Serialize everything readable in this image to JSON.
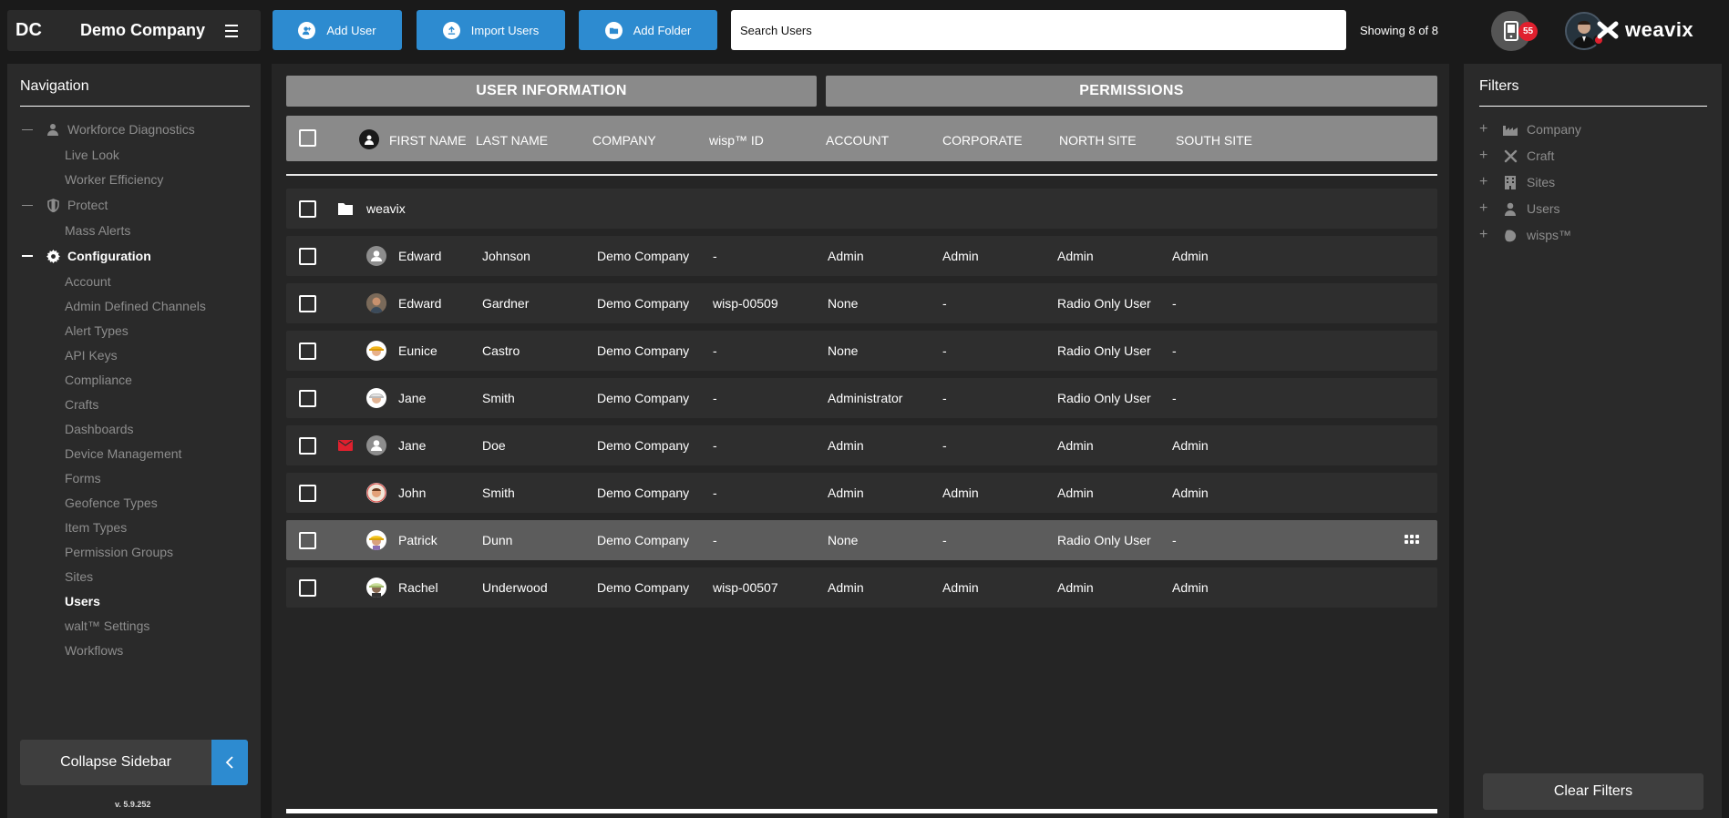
{
  "header": {
    "logo": "DC",
    "company": "Demo Company",
    "add_user": "Add User",
    "import_users": "Import Users",
    "add_folder": "Add Folder",
    "search_placeholder": "Search Users",
    "showing": "Showing 8 of 8",
    "notification_count": "55",
    "brand": "weavix"
  },
  "sidebar": {
    "title": "Navigation",
    "groups": [
      {
        "label": "Workforce Diagnostics",
        "icon": "person-icon",
        "items": [
          "Live Look",
          "Worker Efficiency"
        ]
      },
      {
        "label": "Protect",
        "icon": "shield-icon",
        "items": [
          "Mass Alerts"
        ]
      },
      {
        "label": "Configuration",
        "icon": "gear-icon",
        "active": true,
        "items": [
          "Account",
          "Admin Defined Channels",
          "Alert Types",
          "API Keys",
          "Compliance",
          "Crafts",
          "Dashboards",
          "Device Management",
          "Forms",
          "Geofence Types",
          "Item Types",
          "Permission Groups",
          "Sites",
          "Users",
          "walt™ Settings",
          "Workflows"
        ],
        "active_item": "Users"
      }
    ],
    "collapse_label": "Collapse Sidebar",
    "version": "v. 5.9.252"
  },
  "main": {
    "tabs": [
      "USER INFORMATION",
      "PERMISSIONS"
    ],
    "columns": [
      "FIRST NAME",
      "LAST NAME",
      "COMPANY",
      "wisp™ ID",
      "ACCOUNT",
      "CORPORATE",
      "NORTH SITE",
      "SOUTH SITE"
    ],
    "folder": "weavix",
    "rows": [
      {
        "first": "Edward",
        "last": "Johnson",
        "company": "Demo Company",
        "wisp": "-",
        "account": "Admin",
        "corporate": "Admin",
        "north": "Admin",
        "south": "Admin",
        "avatar": "generic-user-avatar"
      },
      {
        "first": "Edward",
        "last": "Gardner",
        "company": "Demo Company",
        "wisp": "wisp-00509",
        "account": "None",
        "corporate": "-",
        "north": "Radio Only User",
        "south": "-",
        "avatar": "photo-avatar"
      },
      {
        "first": "Eunice",
        "last": "Castro",
        "company": "Demo Company",
        "wisp": "-",
        "account": "None",
        "corporate": "-",
        "north": "Radio Only User",
        "south": "-",
        "avatar": "hardhat-yellow-avatar"
      },
      {
        "first": "Jane",
        "last": "Smith",
        "company": "Demo Company",
        "wisp": "-",
        "account": "Administrator",
        "corporate": "-",
        "north": "Radio Only User",
        "south": "-",
        "avatar": "hardhat-white-avatar"
      },
      {
        "first": "Jane",
        "last": "Doe",
        "company": "Demo Company",
        "wisp": "-",
        "account": "Admin",
        "corporate": "-",
        "north": "Admin",
        "south": "Admin",
        "avatar": "generic-user-avatar",
        "mail": true
      },
      {
        "first": "John",
        "last": "Smith",
        "company": "Demo Company",
        "wisp": "-",
        "account": "Admin",
        "corporate": "Admin",
        "north": "Admin",
        "south": "Admin",
        "avatar": "cartoon-avatar"
      },
      {
        "first": "Patrick",
        "last": "Dunn",
        "company": "Demo Company",
        "wisp": "-",
        "account": "None",
        "corporate": "-",
        "north": "Radio Only User",
        "south": "-",
        "avatar": "hardhat-yellow-avatar",
        "highlighted": true
      },
      {
        "first": "Rachel",
        "last": "Underwood",
        "company": "Demo Company",
        "wisp": "wisp-00507",
        "account": "Admin",
        "corporate": "Admin",
        "north": "Admin",
        "south": "Admin",
        "avatar": "hardhat-green-avatar"
      }
    ]
  },
  "filters": {
    "title": "Filters",
    "items": [
      {
        "label": "Company",
        "icon": "factory-icon"
      },
      {
        "label": "Craft",
        "icon": "tools-icon"
      },
      {
        "label": "Sites",
        "icon": "building-icon"
      },
      {
        "label": "Users",
        "icon": "person-icon"
      },
      {
        "label": "wisps™",
        "icon": "wisp-icon"
      }
    ],
    "clear_label": "Clear Filters"
  },
  "colors": {
    "accent": "#2d8bd0",
    "badge": "#e0202e",
    "header_gray": "#8a8a8a",
    "row_bg": "#2e2e2e",
    "row_highlight": "#5c5c5c"
  }
}
